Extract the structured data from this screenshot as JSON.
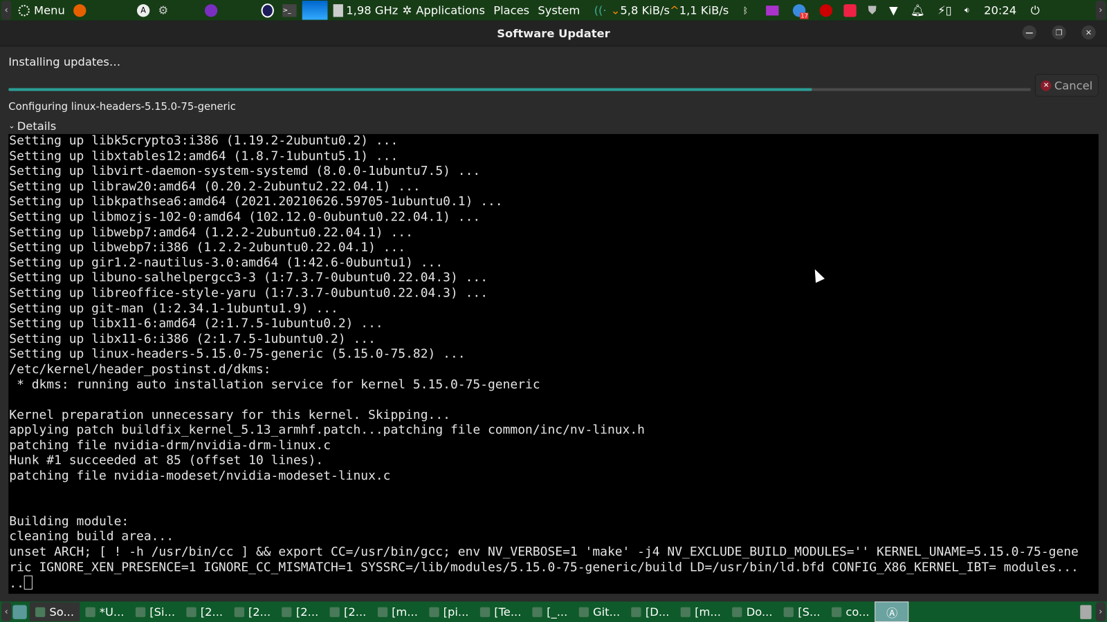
{
  "topbar": {
    "menu_label": "Menu",
    "cpu_freq": "1,98 GHz",
    "applications": "Applications",
    "places": "Places",
    "system": "System",
    "net_down": "5,8 KiB/s",
    "net_up": "1,1 KiB/s",
    "notification_badge": "17",
    "clock": "20:24"
  },
  "window": {
    "title": "Software Updater",
    "status": "Installing updates…",
    "progress_percent": 78.6,
    "cancel_label": "Cancel",
    "configuring": "Configuring linux-headers-5.15.0-75-generic",
    "details_label": "Details",
    "terminal_lines": [
      "Setting up libk5crypto3:i386 (1.19.2-2ubuntu0.2) ...",
      "Setting up libxtables12:amd64 (1.8.7-1ubuntu5.1) ...",
      "Setting up libvirt-daemon-system-systemd (8.0.0-1ubuntu7.5) ...",
      "Setting up libraw20:amd64 (0.20.2-2ubuntu2.22.04.1) ...",
      "Setting up libkpathsea6:amd64 (2021.20210626.59705-1ubuntu0.1) ...",
      "Setting up libmozjs-102-0:amd64 (102.12.0-0ubuntu0.22.04.1) ...",
      "Setting up libwebp7:amd64 (1.2.2-2ubuntu0.22.04.1) ...",
      "Setting up libwebp7:i386 (1.2.2-2ubuntu0.22.04.1) ...",
      "Setting up gir1.2-nautilus-3.0:amd64 (1:42.6-0ubuntu1) ...",
      "Setting up libuno-salhelpergcc3-3 (1:7.3.7-0ubuntu0.22.04.3) ...",
      "Setting up libreoffice-style-yaru (1:7.3.7-0ubuntu0.22.04.3) ...",
      "Setting up git-man (1:2.34.1-1ubuntu1.9) ...",
      "Setting up libx11-6:amd64 (2:1.7.5-1ubuntu0.2) ...",
      "Setting up libx11-6:i386 (2:1.7.5-1ubuntu0.2) ...",
      "Setting up linux-headers-5.15.0-75-generic (5.15.0-75.82) ...",
      "/etc/kernel/header_postinst.d/dkms:",
      " * dkms: running auto installation service for kernel 5.15.0-75-generic",
      "",
      "Kernel preparation unnecessary for this kernel. Skipping...",
      "applying patch buildfix_kernel_5.13_armhf.patch...patching file common/inc/nv-linux.h",
      "patching file nvidia-drm/nvidia-drm-linux.c",
      "Hunk #1 succeeded at 85 (offset 10 lines).",
      "patching file nvidia-modeset/nvidia-modeset-linux.c",
      "",
      "",
      "Building module:",
      "cleaning build area...",
      "unset ARCH; [ ! -h /usr/bin/cc ] && export CC=/usr/bin/gcc; env NV_VERBOSE=1 'make' -j4 NV_EXCLUDE_BUILD_MODULES='' KERNEL_UNAME=5.15.0-75-gene",
      "ric IGNORE_XEN_PRESENCE=1 IGNORE_CC_MISMATCH=1 SYSSRC=/lib/modules/5.15.0-75-generic/build LD=/usr/bin/ld.bfd CONFIG_X86_KERNEL_IBT= modules...",
      ".."
    ]
  },
  "taskbar": {
    "items": [
      {
        "label": "So...",
        "icon": "software-updater-icon",
        "active": true
      },
      {
        "label": "*U...",
        "icon": "text-editor-icon"
      },
      {
        "label": "[Si...",
        "icon": "globe-icon"
      },
      {
        "label": "[2...",
        "icon": "image-icon"
      },
      {
        "label": "[2...",
        "icon": "image-icon"
      },
      {
        "label": "[2...",
        "icon": "image-icon"
      },
      {
        "label": "[2...",
        "icon": "image-icon"
      },
      {
        "label": "[m...",
        "icon": "terminal-icon"
      },
      {
        "label": "[pi...",
        "icon": "folder-icon"
      },
      {
        "label": "[Te...",
        "icon": "telegram-icon"
      },
      {
        "label": "[_...",
        "icon": "document-icon"
      },
      {
        "label": "Git...",
        "icon": "firefox-icon"
      },
      {
        "label": "[D...",
        "icon": "folder-icon"
      },
      {
        "label": "[m...",
        "icon": "archive-icon"
      },
      {
        "label": "Do...",
        "icon": "downloads-folder-icon"
      },
      {
        "label": "[S...",
        "icon": "package-icon"
      },
      {
        "label": "co...",
        "icon": "zip-icon"
      }
    ]
  },
  "colors": {
    "accent": "#2a9d95",
    "panel": "#173d16",
    "taskbar": "#0f5a2a",
    "cancel_icon": "#8a1c2b"
  }
}
